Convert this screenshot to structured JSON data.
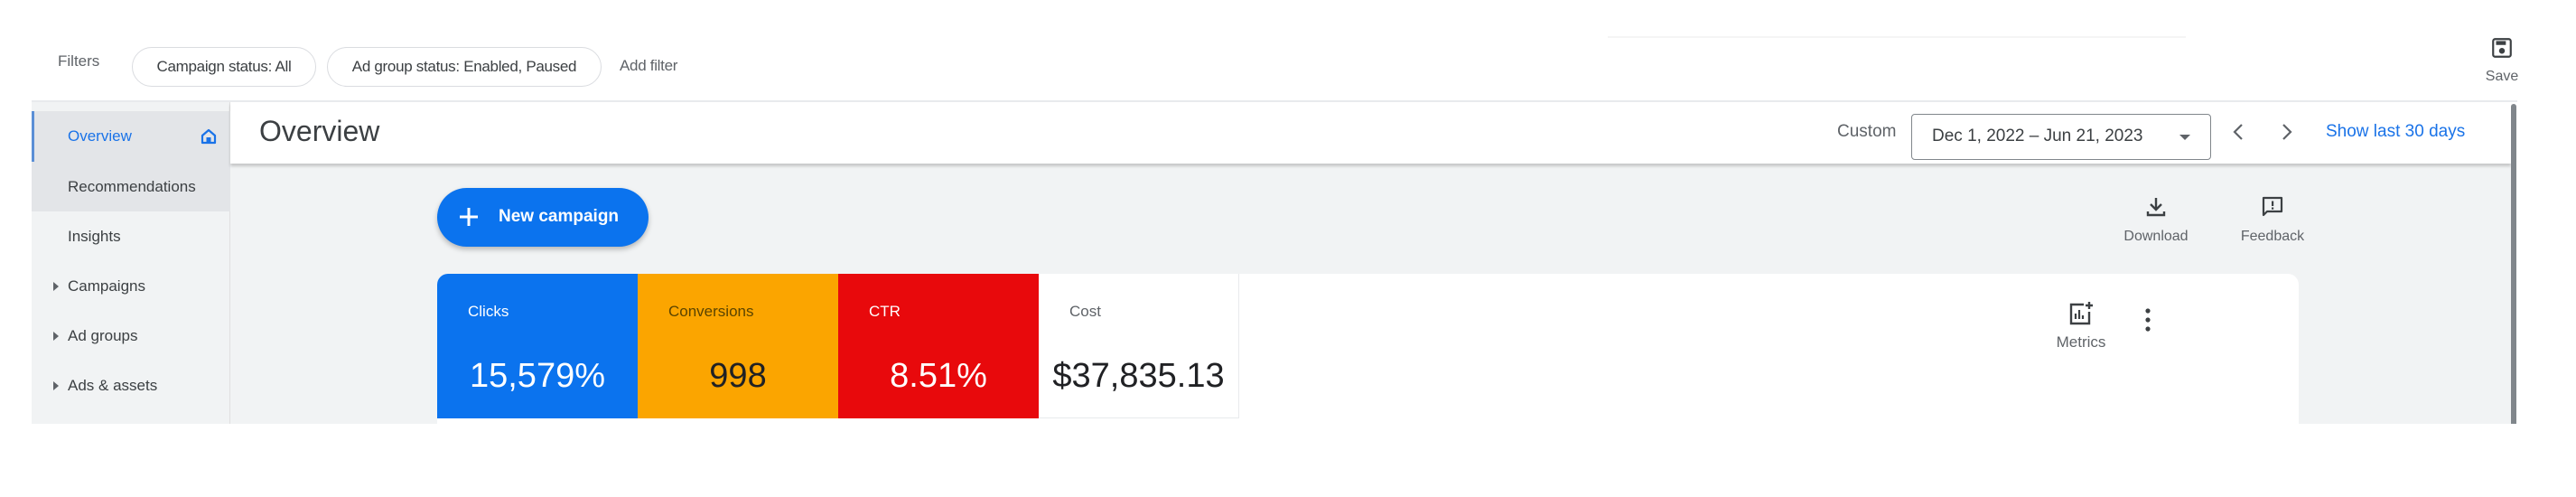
{
  "filters": {
    "label": "Filters",
    "chips": [
      "Campaign status: All",
      "Ad group status: Enabled, Paused"
    ],
    "add_filter": "Add filter"
  },
  "toolbar": {
    "save_label": "Save",
    "save_icon": "save-icon"
  },
  "sidebar": {
    "items": [
      {
        "label": "Overview",
        "active": true,
        "icon": "home-icon"
      },
      {
        "label": "Recommendations"
      },
      {
        "label": "Insights"
      },
      {
        "label": "Campaigns",
        "expandable": true
      },
      {
        "label": "Ad groups",
        "expandable": true
      },
      {
        "label": "Ads & assets",
        "expandable": true
      }
    ]
  },
  "header": {
    "title": "Overview",
    "date_preset": "Custom",
    "date_range": "Dec 1, 2022 – Jun 21, 2023",
    "show_last_label": "Show last 30 days"
  },
  "actions": {
    "new_campaign": "New campaign",
    "download": "Download",
    "feedback": "Feedback"
  },
  "metrics": {
    "tiles": [
      {
        "label": "Clicks",
        "value": "15,579%",
        "color": "#0b73ee"
      },
      {
        "label": "Conversions",
        "value": "998",
        "color": "#fba500"
      },
      {
        "label": "CTR",
        "value": "8.51%",
        "color": "#e8090c"
      },
      {
        "label": "Cost",
        "value": "$37,835.13",
        "color": "#ffffff"
      }
    ],
    "metrics_button": "Metrics"
  },
  "colors": {
    "accent": "#1a73e8",
    "background": "#f1f3f4"
  }
}
